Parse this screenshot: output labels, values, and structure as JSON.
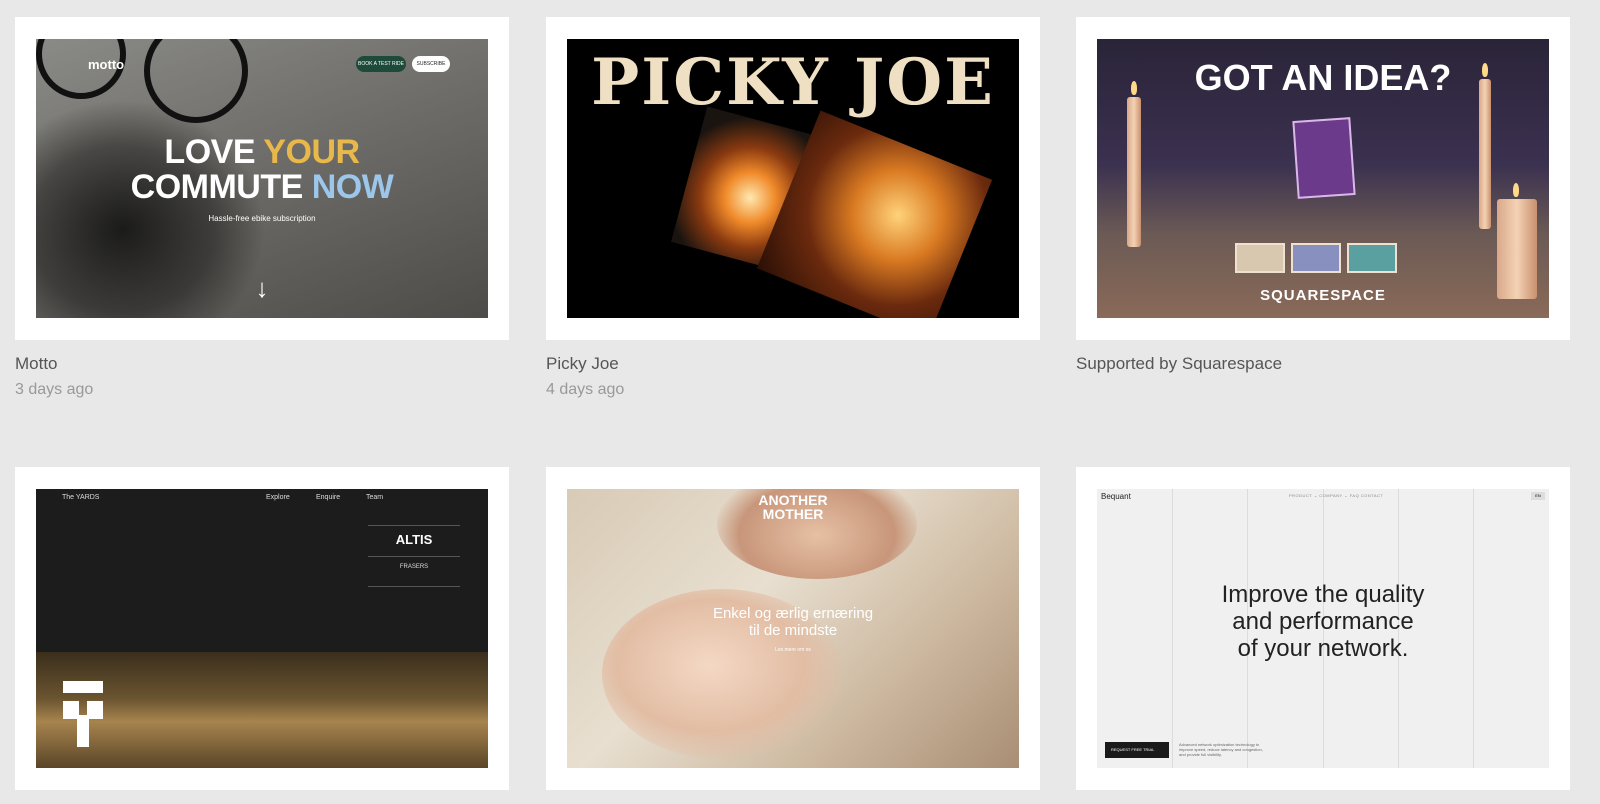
{
  "cards": [
    {
      "title": "Motto",
      "date": "3 days ago",
      "shot": {
        "logo": "motto",
        "nav_button_1": "BOOK A TEST RIDE",
        "nav_button_2": "SUBSCRIBE",
        "headline_1a": "LOVE ",
        "headline_1b": "YOUR",
        "headline_2a": "COMMUTE ",
        "headline_2b": "NOW",
        "subtitle": "Hassle-free ebike subscription",
        "arrow": "↓"
      }
    },
    {
      "title": "Picky Joe",
      "date": "4 days ago",
      "shot": {
        "headline": "PICKY JOE"
      }
    },
    {
      "title": "Supported by Squarespace",
      "shot": {
        "headline": "GOT AN IDEA?",
        "brand": "SQUARESPACE",
        "brand_icon": "squarespace-logo-icon"
      }
    },
    {
      "shot": {
        "logo": "The YARDS",
        "nav": [
          "Explore",
          "Enquire",
          "Team"
        ],
        "partner_1": "ALTIS",
        "partner_2": "FRASERS"
      }
    },
    {
      "shot": {
        "logo_1": "ANOTHER",
        "logo_2": "MOTHER",
        "headline_1": "Enkel og ærlig ernæring",
        "headline_2": "til de mindste",
        "cta": "Les mere om os"
      }
    },
    {
      "shot": {
        "logo": "Bequant",
        "nav": "PRODUCT ⌄   COMPANY ⌄   FAQ   CONTACT",
        "lang": "EN",
        "headline_1": "Improve the quality",
        "headline_2": "and performance",
        "headline_3": "of your network.",
        "button": "REQUEST FREE TRIAL",
        "desc": "Advanced network optimization technology to improve speed, reduce latency and congestion, and provide full visibility."
      }
    }
  ],
  "colors": {
    "background": "#e8e8e8",
    "card": "#ffffff",
    "title": "#555555",
    "date": "#999999"
  }
}
